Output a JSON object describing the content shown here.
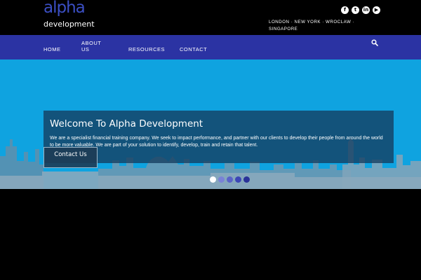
{
  "logo": {
    "main": "alpha",
    "sub": "development"
  },
  "header": {
    "social_icons": [
      {
        "icon": "facebook-icon",
        "glyph": "f"
      },
      {
        "icon": "twitter-icon",
        "glyph": "t"
      },
      {
        "icon": "linkedin-icon",
        "glyph": "in"
      },
      {
        "icon": "youtube-icon",
        "glyph": "▶"
      }
    ],
    "locations": "LONDON · NEW YORK · WROCLAW · SINGAPORE"
  },
  "nav": {
    "items": [
      "HOME",
      "ABOUT US",
      "RESOURCES",
      "CONTACT"
    ],
    "search_icon": "search-icon"
  },
  "hero": {
    "title": "Welcome To Alpha Development",
    "text": "We are a specialist financial training company. We seek to impact performance, and partner with our clients to develop their people from around the world to be more valuable. We are part of your solution to identify, develop, train and retain that talent.",
    "cta_label": "Contact Us",
    "slide_count": 5,
    "active_slide": 1
  },
  "colors": {
    "logo_blue": "#3b4fc4",
    "nav_bg": "#2b33a3",
    "hero_bg": "#0fa3e0",
    "caption_bg": "#143c5f",
    "dot_active": "#ffffff",
    "dot_colors": [
      "#ffffff",
      "#7a82d6",
      "#5a63c8",
      "#3c46b6",
      "#2a3299"
    ]
  }
}
